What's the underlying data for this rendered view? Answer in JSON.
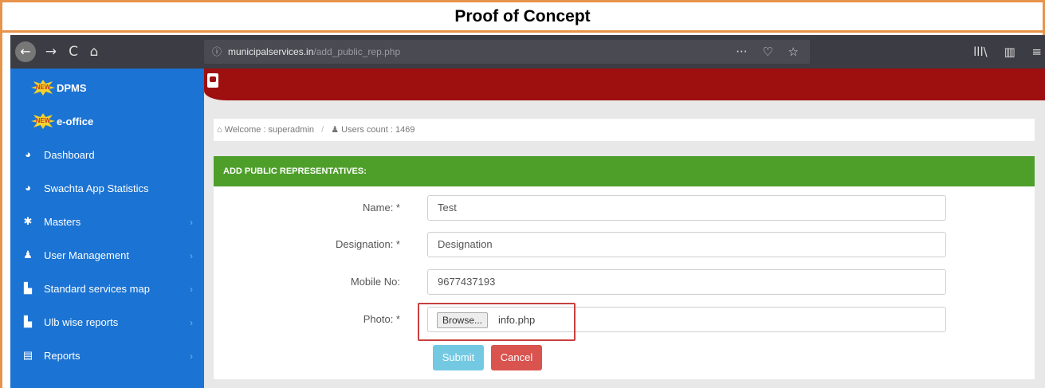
{
  "doc_title": "Proof of Concept",
  "browser": {
    "url_prefix": "municipalservices.in",
    "url_path": "/add_public_rep.php",
    "back_icon": "←",
    "forward_icon": "→",
    "reload_icon": "C",
    "home_icon": "⌂",
    "info_icon": "ⓘ",
    "more_icon": "···",
    "pocket_icon": "♡",
    "star_icon": "☆",
    "library_icon": "lll\\",
    "sidebar_icon": "▥",
    "menu_icon": "≡"
  },
  "sidebar": {
    "items": [
      {
        "label": "DPMS",
        "badge": "NEW",
        "icon": "new-badge-icon"
      },
      {
        "label": "e-office",
        "badge": "NEW",
        "icon": "new-badge-icon"
      },
      {
        "label": "Dashboard",
        "icon": "dashboard-icon",
        "glyph": "◕"
      },
      {
        "label": "Swachta App Statistics",
        "icon": "dashboard-icon",
        "glyph": "◕"
      },
      {
        "label": "Masters",
        "icon": "gear-icon",
        "glyph": "✱",
        "chevron": "›"
      },
      {
        "label": "User Management",
        "icon": "user-icon",
        "glyph": "♟",
        "chevron": "›"
      },
      {
        "label": "Standard services map",
        "icon": "file-icon",
        "glyph": "▙",
        "chevron": "›"
      },
      {
        "label": "Ulb wise reports",
        "icon": "file-icon",
        "glyph": "▙",
        "chevron": "›"
      },
      {
        "label": "Reports",
        "icon": "list-icon",
        "glyph": "▤",
        "chevron": "›"
      }
    ]
  },
  "breadcrumb": {
    "home_glyph": "⌂",
    "welcome": "Welcome : superadmin",
    "separator": "/",
    "users_glyph": "♟",
    "users_count": "Users count : 1469"
  },
  "form": {
    "heading": "ADD PUBLIC REPRESENTATIVES:",
    "name_label": "Name: *",
    "name_value": "Test",
    "designation_label": "Designation: *",
    "designation_value": "Designation",
    "mobile_label": "Mobile No:",
    "mobile_value": "9677437193",
    "photo_label": "Photo: *",
    "browse_label": "Browse...",
    "file_name": "info.php",
    "submit_label": "Submit",
    "cancel_label": "Cancel"
  },
  "colors": {
    "frame": "#e8934a",
    "sidebar": "#1b73d3",
    "header_red": "#9e0f0f",
    "panel_green": "#4e9f2a",
    "submit": "#5bc0de",
    "cancel": "#d9534f",
    "highlight": "#c84040"
  }
}
